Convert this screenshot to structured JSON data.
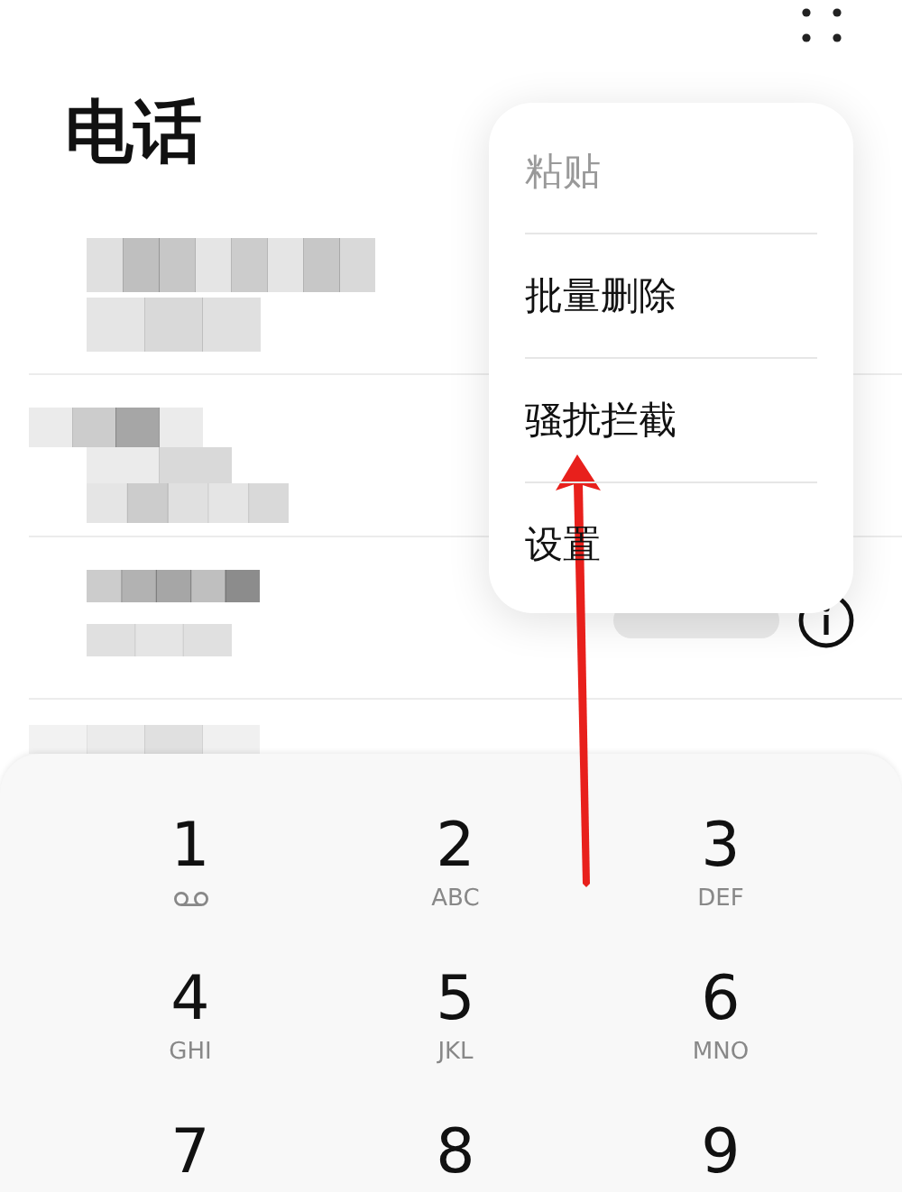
{
  "header": {
    "title": "电话"
  },
  "call_log": [
    {
      "kind": "redacted"
    },
    {
      "kind": "redacted"
    },
    {
      "kind": "redacted_with_info"
    },
    {
      "kind": "redacted"
    }
  ],
  "menu": {
    "items": [
      {
        "label": "粘贴",
        "disabled": true
      },
      {
        "label": "批量删除",
        "disabled": false
      },
      {
        "label": "骚扰拦截",
        "disabled": false
      },
      {
        "label": "设置",
        "disabled": false
      }
    ]
  },
  "keypad": {
    "keys": [
      {
        "digit": "1",
        "kind": "voicemail"
      },
      {
        "digit": "2",
        "kind": "letters",
        "letters": "ABC"
      },
      {
        "digit": "3",
        "kind": "letters",
        "letters": "DEF"
      },
      {
        "digit": "4",
        "kind": "letters",
        "letters": "GHI"
      },
      {
        "digit": "5",
        "kind": "letters",
        "letters": "JKL"
      },
      {
        "digit": "6",
        "kind": "letters",
        "letters": "MNO"
      },
      {
        "digit": "7",
        "kind": "digit_only"
      },
      {
        "digit": "8",
        "kind": "digit_only"
      },
      {
        "digit": "9",
        "kind": "digit_only"
      }
    ]
  },
  "annotation": {
    "kind": "arrow"
  }
}
